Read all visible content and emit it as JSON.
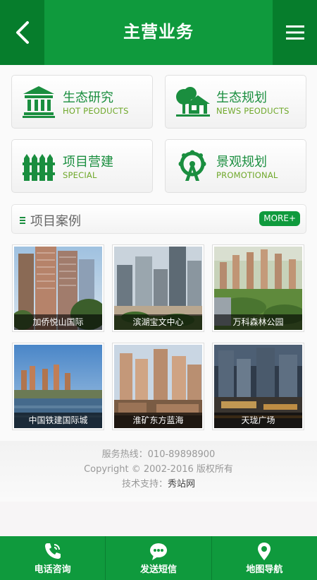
{
  "header": {
    "title": "主营业务",
    "back_icon": "back-arrow-icon",
    "menu_icon": "hamburger-menu-icon"
  },
  "categories": [
    {
      "title": "生态研究",
      "subtitle": "HOT PEODUCTS",
      "icon": "building-columns-icon"
    },
    {
      "title": "生态规划",
      "subtitle": "NEWS PEODUCTS",
      "icon": "house-tree-icon"
    },
    {
      "title": "项目营建",
      "subtitle": "SPECIAL",
      "icon": "fence-icon"
    },
    {
      "title": "景观规划",
      "subtitle": "PROMOTIONAL",
      "icon": "ferris-wheel-icon"
    }
  ],
  "cases": {
    "title": "项目案例",
    "more": "MORE+"
  },
  "projects": [
    {
      "name": "加侨悦山国际"
    },
    {
      "name": "滨湖宝文中心"
    },
    {
      "name": "万科森林公园"
    },
    {
      "name": "中国铁建国际城"
    },
    {
      "name": "淮矿东方蓝海"
    },
    {
      "name": "天珑广场"
    }
  ],
  "footer": {
    "hotline": "服务热线：010-89898900",
    "copyright": "Copyright © 2002-2016 版权所有",
    "support_label": "技术支持：",
    "support_name": "秀站网"
  },
  "bottom_nav": [
    {
      "label": "电话咨询",
      "icon": "phone-icon"
    },
    {
      "label": "发送短信",
      "icon": "message-bubble-icon"
    },
    {
      "label": "地图导航",
      "icon": "map-pin-icon"
    }
  ],
  "colors": {
    "brand_green": "#0f9a3d",
    "dark_green": "#067d2c",
    "subtitle_green": "#6fa82a"
  }
}
